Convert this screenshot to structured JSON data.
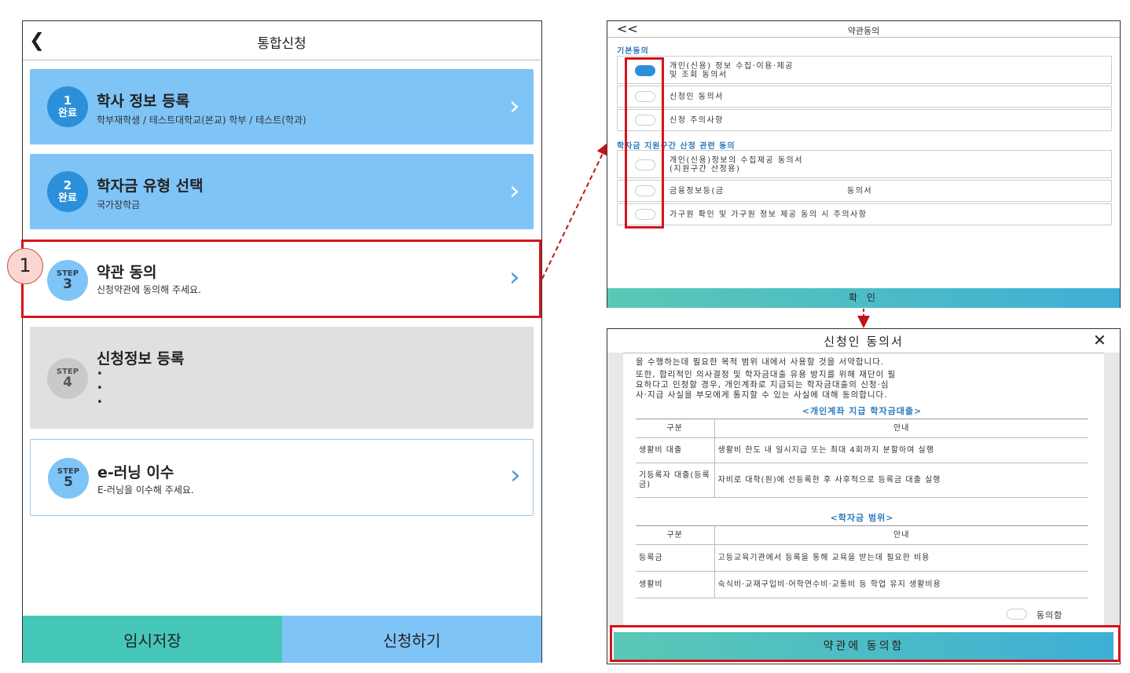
{
  "left": {
    "back_icon": "chevron-left-icon",
    "title": "통합신청",
    "steps": [
      {
        "num": "1",
        "status": "완료",
        "title": "학사 정보 등록",
        "sub": "학부재학생 / 테스트대학교(본교) 학부 / 테스트(학과)"
      },
      {
        "num": "2",
        "status": "완료",
        "title": "학자금 유형 선택",
        "sub": "국가장학금"
      },
      {
        "step": "STEP",
        "num": "3",
        "title": "약관 동의",
        "sub": "신청약관에 동의해 주세요."
      },
      {
        "step": "STEP",
        "num": "4",
        "title": "신청정보 등록",
        "dots": "•"
      },
      {
        "step": "STEP",
        "num": "5",
        "title": "e-러닝 이수",
        "sub": "E-러닝을 이수해 주세요."
      }
    ],
    "chevron": "›",
    "save_label": "임시저장",
    "apply_label": "신청하기",
    "badge": "1"
  },
  "terms": {
    "back": "<<",
    "title": "약관동의",
    "sec1": "기본동의",
    "items1": [
      "개인(신용) 정보 수집·이용·제공",
      "및 조회 동의서",
      "신청인 동의서",
      "신청 주의사항"
    ],
    "sec2": "학자금 지원구간 산정 관련 동의",
    "items2": [
      "개인(신용)정보의 수집제공 동의서",
      "(지원구간 산정용)",
      "금융정보등(금",
      "동의서",
      "가구원 확인 및 가구원 정보 제공 동의 시 주의사항"
    ],
    "confirm": "확 인"
  },
  "consent": {
    "title": "신청인 동의서",
    "close": "✕",
    "p1": "을 수행하는데 필요한 목적 범위 내에서 사용할 것을 서약합니다.",
    "p2": "또한, 합리적인 의사결정 및 학자금대출 유용 방지를 위해 재단이 필",
    "p3": "요하다고 인정할 경우, 개인계좌로 지급되는 학자금대출의 신청·심",
    "p4": "사·지급 사실을 부모에게 통지할 수 있는 사실에 대해 동의합니다.",
    "table1_title": "<개인계좌 지급 학자금대출>",
    "h_k": "구분",
    "h_v": "안내",
    "t1": [
      {
        "k": "생활비 대출",
        "v": "생활비 한도 내 일시지급 또는 최대 4회까지 분할하여 실행"
      },
      {
        "k": "기등록자 대출(등록금)",
        "v": "자비로 대학(원)에 선등록한 후 사후적으로 등록금 대출 실행"
      }
    ],
    "table2_title": "<학자금 범위>",
    "t2": [
      {
        "k": "등록금",
        "v": "고등교육기관에서 등록을 통해 교육을 받는데 필요한 비용"
      },
      {
        "k": "생활비",
        "v": "숙식비·교재구입비·어학연수비·교통비 등 학업 유지 생활비용"
      }
    ],
    "agree_check": "동의함",
    "agree_button": "약관에 동의함"
  },
  "colors": {
    "highlight": "#d6141b",
    "done": "#7fc4f7",
    "teal": "#45c7b8"
  }
}
